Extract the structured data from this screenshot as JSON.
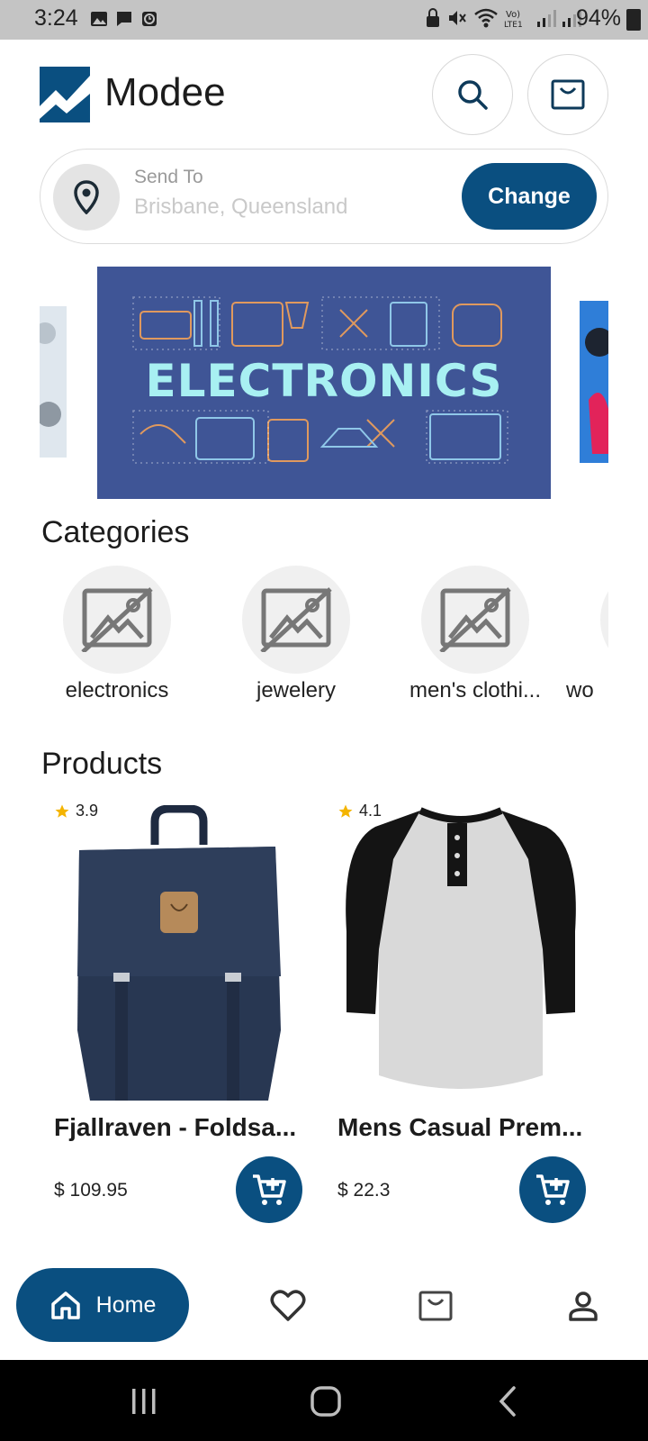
{
  "status_bar": {
    "time": "3:24",
    "battery": "94%"
  },
  "header": {
    "app_title": "Modee"
  },
  "address": {
    "label": "Send To",
    "value": "Brisbane, Queensland",
    "change_label": "Change"
  },
  "banner": {
    "title": "ELECTRONICS"
  },
  "categories": {
    "title": "Categories",
    "items": [
      {
        "label": "electronics"
      },
      {
        "label": "jewelery"
      },
      {
        "label": "men's clothi..."
      },
      {
        "label": "wo"
      }
    ]
  },
  "products": {
    "title": "Products",
    "items": [
      {
        "name": "Fjallraven - Foldsa...",
        "price": "$ 109.95",
        "rating": "3.9"
      },
      {
        "name": "Mens Casual Prem...",
        "price": "$ 22.3",
        "rating": "4.1"
      }
    ]
  },
  "bottom_nav": {
    "home_label": "Home"
  },
  "colors": {
    "primary": "#0a4f80",
    "star": "#f4b400",
    "banner_bg": "#3f5596"
  }
}
